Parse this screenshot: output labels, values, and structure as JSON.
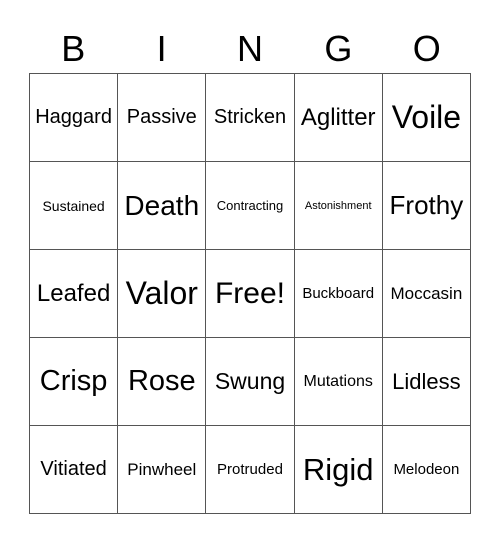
{
  "header": [
    "B",
    "I",
    "N",
    "G",
    "O"
  ],
  "cells": [
    [
      "Haggard",
      "Passive",
      "Stricken",
      "Aglitter",
      "Voile"
    ],
    [
      "Sustained",
      "Death",
      "Contracting",
      "Astonishment",
      "Frothy"
    ],
    [
      "Leafed",
      "Valor",
      "Free!",
      "Buckboard",
      "Moccasin"
    ],
    [
      "Crisp",
      "Rose",
      "Swung",
      "Mutations",
      "Lidless"
    ],
    [
      "Vitiated",
      "Pinwheel",
      "Protruded",
      "Rigid",
      "Melodeon"
    ]
  ]
}
